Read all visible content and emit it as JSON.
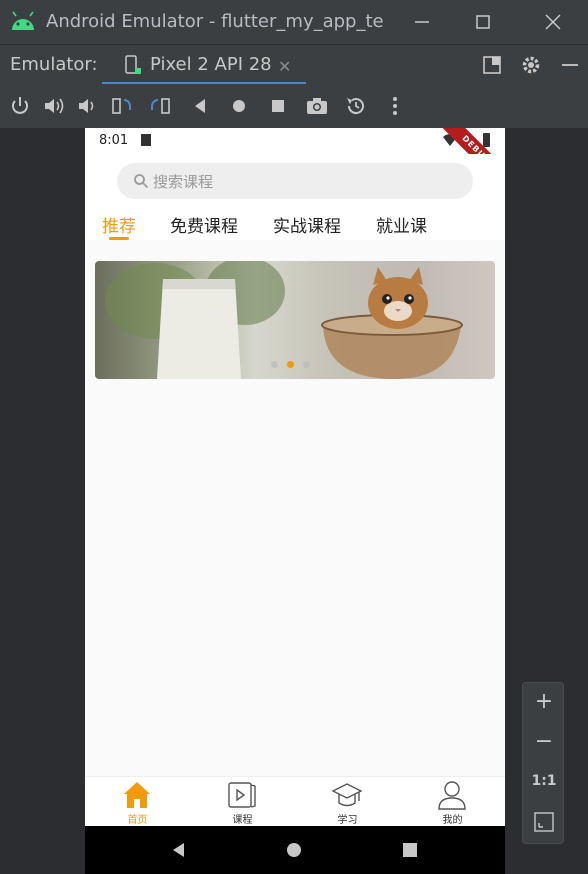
{
  "window": {
    "title": "Android Emulator - flutter_my_app_te"
  },
  "emulator_bar": {
    "label": "Emulator:",
    "device_tab": "Pixel 2 API 28",
    "close_glyph": "✕"
  },
  "status_bar": {
    "time": "8:01",
    "debug_banner": "DEBUG"
  },
  "search": {
    "placeholder": "搜索课程"
  },
  "tabs": [
    {
      "label": "推荐",
      "active": true
    },
    {
      "label": "免费课程",
      "active": false
    },
    {
      "label": "实战课程",
      "active": false
    },
    {
      "label": "就业课",
      "active": false
    }
  ],
  "carousel": {
    "page_count": 3,
    "active_index": 1
  },
  "bottom_nav": [
    {
      "label": "首页",
      "icon": "home-icon",
      "active": true
    },
    {
      "label": "课程",
      "icon": "course-icon",
      "active": false
    },
    {
      "label": "学习",
      "icon": "study-icon",
      "active": false
    },
    {
      "label": "我的",
      "icon": "profile-icon",
      "active": false
    }
  ],
  "zoom_panel": {
    "plus": "+",
    "minus": "−",
    "one_to_one": "1:1"
  },
  "colors": {
    "accent": "#f29a0e",
    "ide_bg": "#3c3f41",
    "tab_underline": "#4a88c7"
  }
}
